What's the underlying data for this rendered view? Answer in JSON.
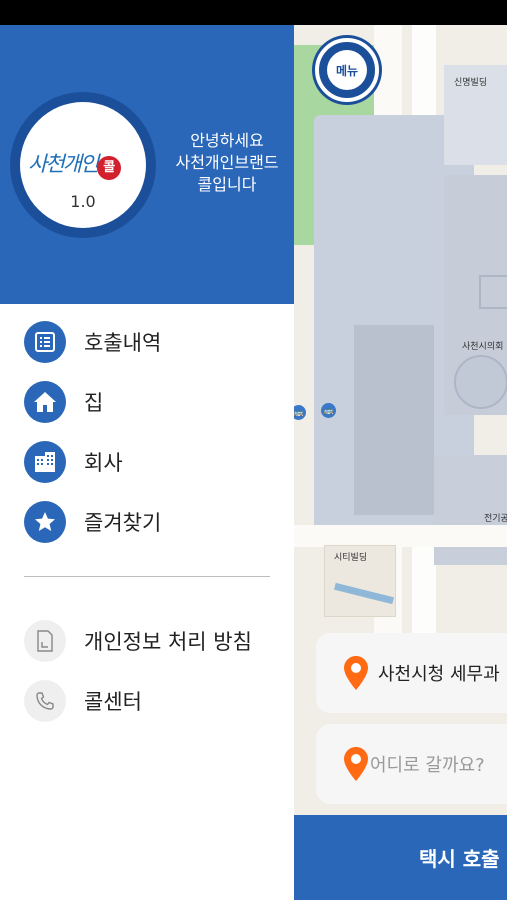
{
  "drawer": {
    "logo": {
      "text": "사천개인",
      "badge": "콜",
      "version": "1.0"
    },
    "greeting": [
      "안녕하세요",
      "사천개인브랜드",
      "콜입니다"
    ],
    "menu": [
      {
        "label": "호출내역",
        "icon": "list-icon"
      },
      {
        "label": "집",
        "icon": "home-icon"
      },
      {
        "label": "회사",
        "icon": "building-icon"
      },
      {
        "label": "즐겨찾기",
        "icon": "star-icon"
      }
    ],
    "sub_menu": [
      {
        "label": "개인정보 처리 방침",
        "icon": "document-icon"
      },
      {
        "label": "콜센터",
        "icon": "phone-icon"
      }
    ]
  },
  "map": {
    "menu_button": "메뉴",
    "labels": [
      "신명빌딩",
      "사천시의회",
      "전기공",
      "시티빌딩"
    ]
  },
  "origin": {
    "text": "사천시청 세무과"
  },
  "destination": {
    "placeholder": "어디로 갈까요?"
  },
  "call_button": "택시 호출",
  "colors": {
    "primary": "#2a67b9",
    "dark": "#1c4f9a",
    "pin": "#ff6a13"
  }
}
